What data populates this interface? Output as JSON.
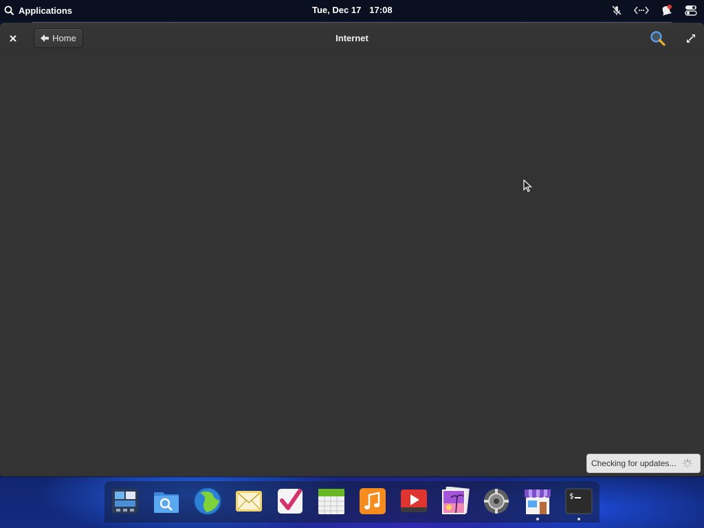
{
  "top_panel": {
    "applications_label": "Applications",
    "date": "Tue, Dec 17",
    "time": "17:08",
    "indicators": [
      "microphone-muted-icon",
      "network-wired-icon",
      "notifications-icon",
      "system-toggles-icon"
    ]
  },
  "window": {
    "title": "Internet",
    "home_label": "Home",
    "close_icon": "close-icon",
    "search_icon": "search-icon",
    "maximize_icon": "maximize-icon"
  },
  "toast": {
    "text": "Checking for updates..."
  },
  "dock": {
    "items": [
      {
        "name": "multitasking-view",
        "running": false
      },
      {
        "name": "files",
        "running": false
      },
      {
        "name": "web-browser",
        "running": false
      },
      {
        "name": "mail",
        "running": false
      },
      {
        "name": "tasks",
        "running": false
      },
      {
        "name": "calendar",
        "running": false
      },
      {
        "name": "music",
        "running": false
      },
      {
        "name": "videos",
        "running": false
      },
      {
        "name": "photos",
        "running": false
      },
      {
        "name": "system-settings",
        "running": false
      },
      {
        "name": "appcenter",
        "running": true
      },
      {
        "name": "terminal",
        "running": true
      }
    ]
  },
  "colors": {
    "window_bg": "#333333",
    "panel_bg": "#0a1020",
    "accent_red": "#e0342f"
  }
}
